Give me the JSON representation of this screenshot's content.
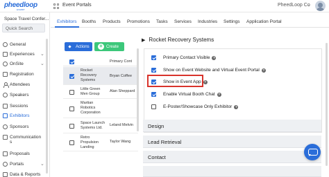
{
  "app": {
    "logo_text": "pheedloop",
    "logo_sub": "EXHIBIT",
    "page_title": "Event Portals",
    "user_name": "PheedLoop Co"
  },
  "sidebar": {
    "event_name": "Space Travel Confer...",
    "quick_search_placeholder": "Quick Search",
    "items": [
      {
        "label": "General",
        "icon": "gear-icon"
      },
      {
        "label": "Experiences",
        "icon": "star-icon",
        "chevron": "⌄"
      },
      {
        "label": "OnSite",
        "icon": "location-icon",
        "chevron": "⌄"
      },
      {
        "label": "Registration",
        "icon": "ticket-icon"
      },
      {
        "label": "Attendees",
        "icon": "users-icon"
      },
      {
        "label": "Speakers",
        "icon": "microphone-icon"
      },
      {
        "label": "Sessions",
        "icon": "calendar-icon"
      },
      {
        "label": "Exhibitors",
        "icon": "store-icon"
      },
      {
        "label": "Sponsors",
        "icon": "badge-icon"
      },
      {
        "label": "Communications",
        "icon": "message-icon"
      },
      {
        "label": "Proposals",
        "icon": "document-icon"
      },
      {
        "label": "Portals",
        "icon": "portal-icon",
        "chevron": "⌄"
      },
      {
        "label": "Data & Reports",
        "icon": "chart-icon"
      }
    ],
    "communications_line1": "Communication",
    "communications_line2": "s"
  },
  "tabs": [
    "Exhibitors",
    "Booths",
    "Products",
    "Promotions",
    "Tasks",
    "Services",
    "Industries",
    "Settings",
    "Application Portal"
  ],
  "list": {
    "actions_label": "Actions",
    "create_label": "Create",
    "col_contact": "Primary Cont",
    "rows": [
      {
        "name": [
          "Rocket",
          "Recovery",
          "Systems"
        ],
        "contact": "Bryan Coffee",
        "checked": true
      },
      {
        "name": [
          "Little Green",
          "Men Group"
        ],
        "contact": "Alan Sheppard",
        "checked": false
      },
      {
        "name": [
          "Martian",
          "Robotics",
          "Corporation"
        ],
        "contact": "",
        "checked": false
      },
      {
        "name": [
          "Space Launch",
          "Systems Ltd."
        ],
        "contact": "Leland Melvin",
        "checked": false
      },
      {
        "name": [
          "Retro",
          "Propulsion",
          "Landing"
        ],
        "contact": "Taylor Wang",
        "checked": false
      }
    ]
  },
  "detail": {
    "title": "Rocket Recovery Systems",
    "settings": [
      {
        "label": "Primary Contact Visible",
        "checked": true
      },
      {
        "label": "Show on Event Website and Virtual Event Portal",
        "checked": true
      },
      {
        "label": "Show in Event App",
        "checked": true
      },
      {
        "label": "Enable Virtual Booth Chat",
        "checked": true
      },
      {
        "label": "E-Poster/Showcase Only Exhibitor",
        "checked": false
      }
    ],
    "sections": [
      "Design",
      "Lead Retrieval",
      "Contact"
    ]
  },
  "colors": {
    "accent": "#2a6dd9",
    "create_green": "#3cc77a",
    "highlight_red": "#d8332b"
  }
}
